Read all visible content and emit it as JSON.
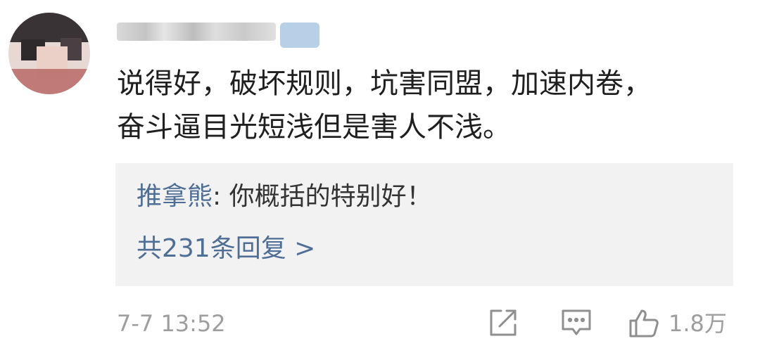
{
  "comment": {
    "text": "说得好，破坏规则，坑害同盟，加速内卷，\n奋斗逼目光短浅但是害人不浅。"
  },
  "reply_preview": {
    "author": "推拿熊",
    "separator": ": ",
    "text": "你概括的特别好！",
    "total_label": "共231条回复 >"
  },
  "footer": {
    "timestamp": "7-7 13:52",
    "like_count": "1.8万"
  },
  "icons": {
    "share": "share-icon",
    "reply": "comment-icon",
    "like": "thumbs-up-icon"
  },
  "colors": {
    "link": "#4f6e96",
    "meta": "#9e9e9e",
    "reply_bg": "#f2f2f2"
  }
}
